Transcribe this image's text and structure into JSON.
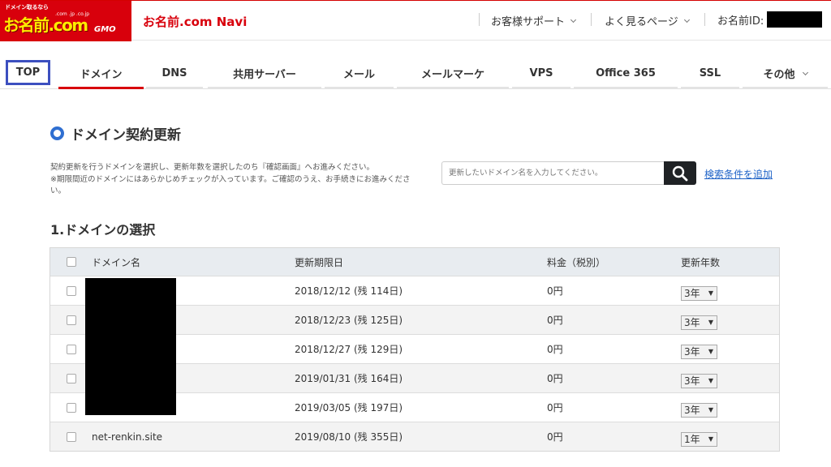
{
  "header": {
    "logo": {
      "tagline": "ドメイン取るなら",
      "main": "お名前.com",
      "domains": ".com .jp .co.jp",
      "gmo": "GMO"
    },
    "app_title": "お名前.com Navi",
    "links": [
      {
        "label": "お客様サポート"
      },
      {
        "label": "よく見るページ"
      }
    ],
    "user_label": "お名前ID:"
  },
  "tabs": [
    {
      "label": "TOP"
    },
    {
      "label": "ドメイン"
    },
    {
      "label": "DNS"
    },
    {
      "label": "共用サーバー"
    },
    {
      "label": "メール"
    },
    {
      "label": "メールマーケ"
    },
    {
      "label": "VPS"
    },
    {
      "label": "Office 365"
    },
    {
      "label": "SSL"
    },
    {
      "label": "その他"
    }
  ],
  "page": {
    "title": "ドメイン契約更新",
    "description_1": "契約更新を行うドメインを選択し、更新年数を選択したのち『確認画面』へお進みください。",
    "description_2": "※期限間近のドメインにはあらかじめチェックが入っています。ご確認のうえ、お手続きにお進みください。",
    "search_placeholder": "更新したいドメイン名を入力してください。",
    "advanced_search": "検索条件を追加",
    "section_title": "1.ドメインの選択"
  },
  "table": {
    "columns": [
      "ドメイン名",
      "更新期限日",
      "料金（税別）",
      "更新年数"
    ],
    "rows": [
      {
        "domain": "",
        "expiry": "2018/12/12 (残 114日)",
        "price": "0円",
        "years": "3年"
      },
      {
        "domain": "",
        "expiry": "2018/12/23 (残 125日)",
        "price": "0円",
        "years": "3年"
      },
      {
        "domain": "",
        "expiry": "2018/12/27 (残 129日)",
        "price": "0円",
        "years": "3年"
      },
      {
        "domain": "",
        "expiry": "2019/01/31 (残 164日)",
        "price": "0円",
        "years": "3年"
      },
      {
        "domain": "",
        "expiry": "2019/03/05 (残 197日)",
        "price": "0円",
        "years": "3年"
      },
      {
        "domain": "net-renkin.site",
        "expiry": "2019/08/10 (残 355日)",
        "price": "0円",
        "years": "1年"
      }
    ]
  },
  "colors": {
    "brand_red": "#d8000c",
    "accent_blue": "#2f6fd1",
    "link_blue": "#1f63c7",
    "highlight": "#3c4fbf"
  }
}
